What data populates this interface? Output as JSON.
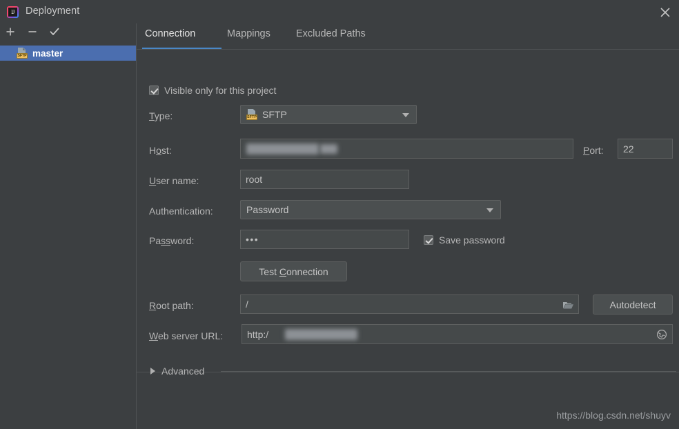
{
  "window": {
    "title": "Deployment",
    "app_icon": "intellij-idea-icon",
    "close_label": "×"
  },
  "sidebar": {
    "toolbar": [
      {
        "name": "add-server-button",
        "icon": "plus-icon",
        "label": "+"
      },
      {
        "name": "remove-server-button",
        "icon": "minus-icon",
        "label": "−"
      },
      {
        "name": "set-default-button",
        "icon": "check-icon",
        "label": "✓"
      }
    ],
    "items": [
      {
        "label": "master",
        "icon": "sftp-server-icon",
        "badge": "SFTP",
        "selected": true
      }
    ]
  },
  "tabs": [
    {
      "label": "Connection",
      "active": true
    },
    {
      "label": "Mappings",
      "active": false
    },
    {
      "label": "Excluded Paths",
      "active": false
    }
  ],
  "form": {
    "visible_only_checkbox": {
      "label": "Visible only for this project",
      "checked": true
    },
    "type": {
      "label": "Type:",
      "mnemonic": "T",
      "value": "SFTP",
      "icon": "sftp-type-icon",
      "badge": "SFTP"
    },
    "host": {
      "label": "Host:",
      "mnemonic": "o",
      "value": "",
      "redacted": true
    },
    "port": {
      "label": "Port:",
      "mnemonic": "P",
      "value": "22"
    },
    "username": {
      "label": "User name:",
      "mnemonic": "U",
      "value": "root"
    },
    "authentication": {
      "label": "Authentication:",
      "value": "Password"
    },
    "password": {
      "label": "Password:",
      "mnemonic": "ss",
      "value": "•••"
    },
    "save_password_checkbox": {
      "label": "Save password",
      "checked": true
    },
    "test_connection_button": {
      "label": "Test Connection",
      "mnemonic": "C"
    },
    "root_path": {
      "label": "Root path:",
      "mnemonic": "R",
      "value": "/",
      "browse_icon": "folder-icon"
    },
    "autodetect_button": {
      "label": "Autodetect"
    },
    "web_server_url": {
      "label": "Web server URL:",
      "mnemonic": "W",
      "value": "http:/",
      "redacted": true,
      "open_icon": "globe-icon"
    },
    "advanced": {
      "label": "Advanced",
      "expanded": false,
      "icon": "chevron-right-icon"
    }
  },
  "watermark": {
    "text": "https://blog.csdn.net/shuyv"
  },
  "colors": {
    "background": "#3c3f41",
    "selection_blue": "#4b6eaf",
    "tab_accent": "#4a88c7",
    "field_background": "#45494a",
    "border": "#5e6060",
    "text": "#b6b6b6",
    "badge_yellow": "#f0c060"
  }
}
